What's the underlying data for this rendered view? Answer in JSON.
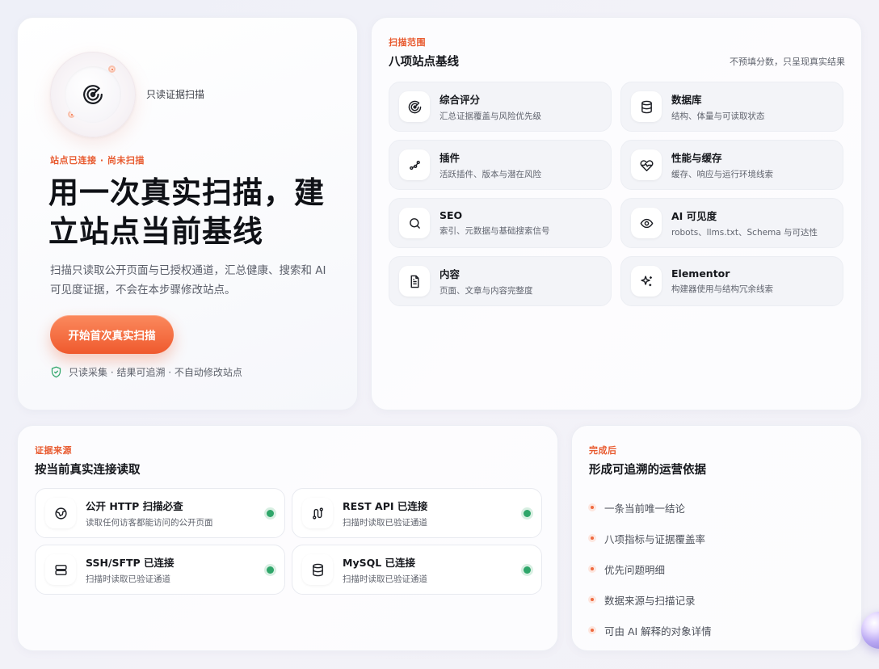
{
  "hero": {
    "radar_label": "只读证据扫描",
    "status": "站点已连接 · 尚未扫描",
    "headline": "用一次真实扫描，建立站点当前基线",
    "description": "扫描只读取公开页面与已授权通道，汇总健康、搜索和 AI 可见度证据，不会在本步骤修改站点。",
    "cta_label": "开始首次真实扫描",
    "assurance": "只读采集 · 结果可追溯 · 不自动修改站点"
  },
  "scope": {
    "eyebrow": "扫描范围",
    "title": "八项站点基线",
    "note": "不预填分数，只呈现真实结果",
    "items": [
      {
        "title": "综合评分",
        "desc": "汇总证据覆盖与风险优先级",
        "icon": "radar-icon"
      },
      {
        "title": "数据库",
        "desc": "结构、体量与可读取状态",
        "icon": "database-icon"
      },
      {
        "title": "插件",
        "desc": "活跃插件、版本与潜在风险",
        "icon": "plugin-icon"
      },
      {
        "title": "性能与缓存",
        "desc": "缓存、响应与运行环境线索",
        "icon": "heartbeat-icon"
      },
      {
        "title": "SEO",
        "desc": "索引、元数据与基础搜索信号",
        "icon": "search-icon"
      },
      {
        "title": "AI 可见度",
        "desc": "robots、llms.txt、Schema 与可达性",
        "icon": "eye-icon"
      },
      {
        "title": "内容",
        "desc": "页面、文章与内容完整度",
        "icon": "document-icon"
      },
      {
        "title": "Elementor",
        "desc": "构建器使用与结构冗余线索",
        "icon": "sparkle-icon"
      }
    ]
  },
  "sources": {
    "eyebrow": "证据来源",
    "title": "按当前真实连接读取",
    "items": [
      {
        "title": "公开 HTTP 扫描必查",
        "desc": "读取任何访客都能访问的公开页面",
        "icon": "globe-icon"
      },
      {
        "title": "REST API 已连接",
        "desc": "扫描时读取已验证通道",
        "icon": "api-route-icon"
      },
      {
        "title": "SSH/SFTP 已连接",
        "desc": "扫描时读取已验证通道",
        "icon": "server-icon"
      },
      {
        "title": "MySQL 已连接",
        "desc": "扫描时读取已验证通道",
        "icon": "database-icon"
      }
    ],
    "status_color": "#2fa66a"
  },
  "outcome": {
    "eyebrow": "完成后",
    "title": "形成可追溯的运营依据",
    "items": [
      "一条当前唯一结论",
      "八项指标与证据覆盖率",
      "优先问题明细",
      "数据来源与扫描记录",
      "可由 AI 解释的对象详情"
    ]
  },
  "colors": {
    "accent": "#ef5a2e",
    "eyebrow": "#e85a2f",
    "ok": "#2fa66a"
  }
}
